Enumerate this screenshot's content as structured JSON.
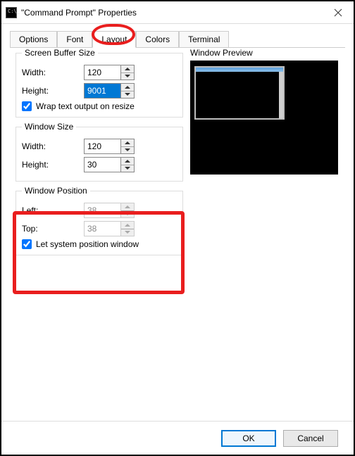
{
  "window": {
    "title": "\"Command Prompt\" Properties"
  },
  "tabs": {
    "options": "Options",
    "font": "Font",
    "layout": "Layout",
    "colors": "Colors",
    "terminal": "Terminal",
    "active": "layout"
  },
  "bufferSize": {
    "legend": "Screen Buffer Size",
    "widthLabel": "Width:",
    "heightLabel": "Height:",
    "width": "120",
    "height": "9001",
    "wrapLabel": "Wrap text output on resize",
    "wrapChecked": true
  },
  "windowSize": {
    "legend": "Window Size",
    "widthLabel": "Width:",
    "heightLabel": "Height:",
    "width": "120",
    "height": "30"
  },
  "windowPos": {
    "legend": "Window Position",
    "leftLabel": "Left:",
    "topLabel": "Top:",
    "left": "38",
    "top": "38",
    "autoLabel": "Let system position window",
    "autoChecked": true
  },
  "preview": {
    "title": "Window Preview"
  },
  "buttons": {
    "ok": "OK",
    "cancel": "Cancel"
  }
}
